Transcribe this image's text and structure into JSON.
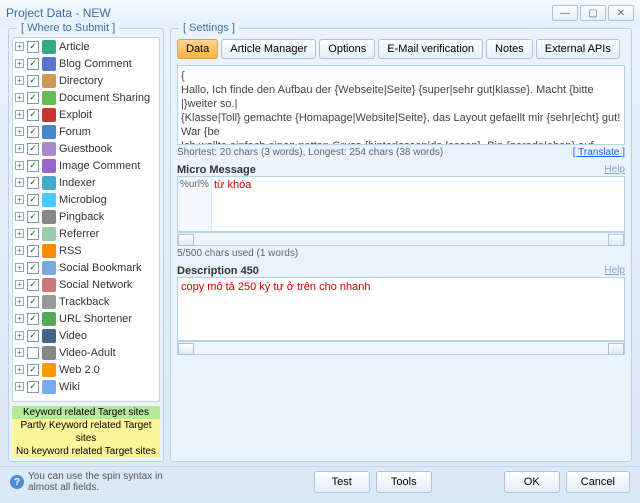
{
  "window": {
    "title": "Project Data - NEW",
    "min": "—",
    "max": "▢",
    "close": "✕"
  },
  "left": {
    "title": "[ Where to Submit ]",
    "items": [
      {
        "label": "Article",
        "checked": true,
        "icon": "#3a8"
      },
      {
        "label": "Blog Comment",
        "checked": true,
        "icon": "#57c"
      },
      {
        "label": "Directory",
        "checked": true,
        "icon": "#c95"
      },
      {
        "label": "Document Sharing",
        "checked": true,
        "icon": "#6b5"
      },
      {
        "label": "Exploit",
        "checked": true,
        "icon": "#c33"
      },
      {
        "label": "Forum",
        "checked": true,
        "icon": "#48c"
      },
      {
        "label": "Guestbook",
        "checked": true,
        "icon": "#a8c"
      },
      {
        "label": "Image Comment",
        "checked": true,
        "icon": "#96c"
      },
      {
        "label": "Indexer",
        "checked": true,
        "icon": "#4ac"
      },
      {
        "label": "Microblog",
        "checked": true,
        "icon": "#4cf"
      },
      {
        "label": "Pingback",
        "checked": true,
        "icon": "#888"
      },
      {
        "label": "Referrer",
        "checked": true,
        "icon": "#9ca"
      },
      {
        "label": "RSS",
        "checked": true,
        "icon": "#f80"
      },
      {
        "label": "Social Bookmark",
        "checked": true,
        "icon": "#7ad"
      },
      {
        "label": "Social Network",
        "checked": true,
        "icon": "#c77"
      },
      {
        "label": "Trackback",
        "checked": true,
        "icon": "#999"
      },
      {
        "label": "URL Shortener",
        "checked": true,
        "icon": "#5a5"
      },
      {
        "label": "Video",
        "checked": true,
        "icon": "#468"
      },
      {
        "label": "Video-Adult",
        "checked": false,
        "icon": "#888"
      },
      {
        "label": "Web 2.0",
        "checked": true,
        "icon": "#f90"
      },
      {
        "label": "Wiki",
        "checked": true,
        "icon": "#7ae"
      }
    ],
    "legend": {
      "a": "Keyword related Target sites",
      "b": "Partly Keyword related Target sites",
      "c": "No keyword related Target sites"
    }
  },
  "right": {
    "title": "[ Settings ]",
    "tabs": [
      "Data",
      "Article Manager",
      "Options",
      "E-Mail verification",
      "Notes",
      "External APIs"
    ],
    "message": "{\nHallo, Ich finde den Aufbau der {Webseite|Seite} {super|sehr gut|klasse}. Macht {bitte |}weiter so.|\n{Klasse|Toll} gemachte {Homapage|Website|Seite}, das Layout gefaellt mir {sehr|echt} gut! War {be\nIch wollte einfach einen netten Gruss {hinterlassen|da lassen}. Bin {gerade|eben} auf {die|eure} {Ho\nZufaellig bin ich auf {eure Seite|eurem Portal} gelandet und muss {feststellen|sagen}, dass mir diese\n{Super|klasse|Schoene} {Webseite|Seite}, ich komme {sicher |}mal wieder vorbei.|\n{Hey ||}Danke fuer die schoene Zeit {hier|auf dieser Webseite}. Macht weiter {bitte |}so. Da {komme",
    "stats": "Shortest: 20 chars (3 words), Longest: 254 chars (38 words)",
    "translate": "[ Translate ]",
    "micro_title": "Micro Message",
    "micro_help": "Help",
    "micro_prefix": "%url%",
    "micro_value": "từ khóa",
    "micro_stats": "5/500 chars used (1 words)",
    "desc_title": "Description 450",
    "desc_help": "Help",
    "desc_value": "copy mô tả 250 ký tự ở trên cho nhanh"
  },
  "footer": {
    "hint1": "You can use the spin syntax in",
    "hint2": "almost all fields.",
    "test": "Test",
    "tools": "Tools",
    "ok": "OK",
    "cancel": "Cancel"
  }
}
